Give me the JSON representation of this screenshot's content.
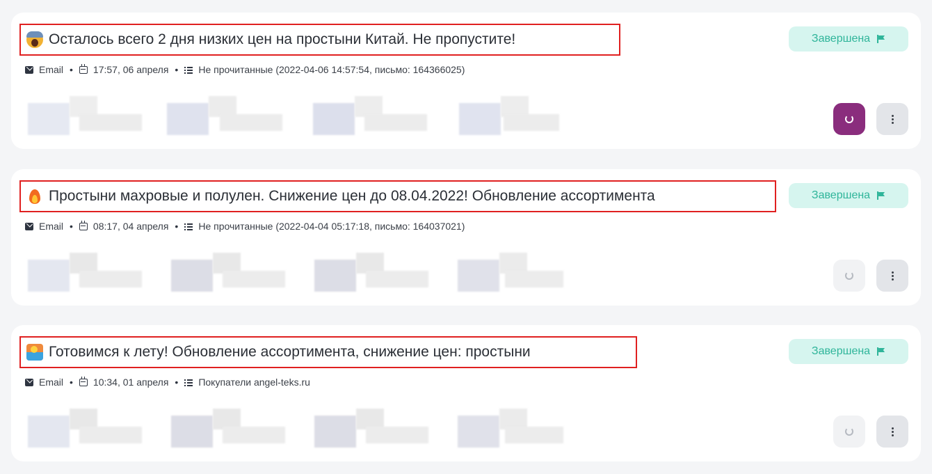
{
  "campaigns": [
    {
      "emoji_icon": "face-screaming-icon",
      "title": "Осталось всего 2 дня низких цен на простыни Китай. Не пропустите!",
      "channel": "Email",
      "datetime": "17:57, 06 апреля",
      "audience": "Не прочитанные (2022-04-06 14:57:54, письмо: 164366025)",
      "status": "Завершена",
      "refresh_active": true
    },
    {
      "emoji_icon": "fire-icon",
      "title": "Простыни махровые и полулен. Снижение цен до 08.04.2022! Обновление ассортимента",
      "channel": "Email",
      "datetime": "08:17, 04 апреля",
      "audience": "Не прочитанные (2022-04-04 05:17:18, письмо: 164037021)",
      "status": "Завершена",
      "refresh_active": false
    },
    {
      "emoji_icon": "beach-icon",
      "title": "Готовимся к лету! Обновление ассортимента, снижение цен: простыни",
      "channel": "Email",
      "datetime": "10:34, 01 апреля",
      "audience": "Покупатели angel-teks.ru",
      "status": "Завершена",
      "refresh_active": false
    }
  ],
  "colors": {
    "status_bg": "#d6f5ef",
    "status_text": "#2fb59a",
    "refresh_active_bg": "#8a2d7d",
    "highlight_border": "#e02020"
  }
}
